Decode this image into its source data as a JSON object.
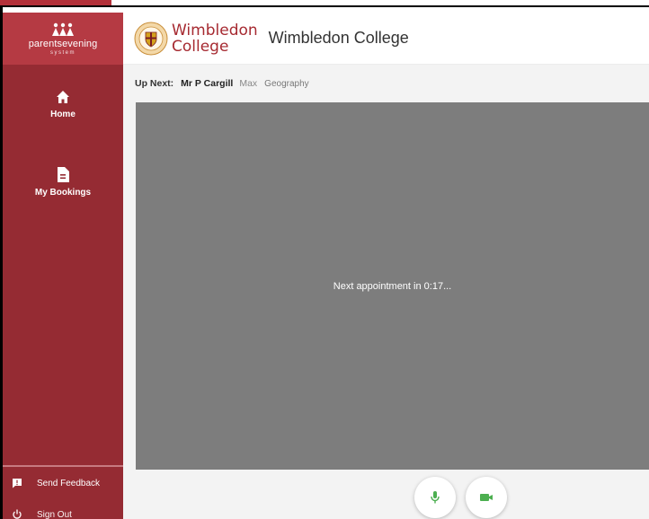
{
  "sidebar": {
    "brand_text": "parentsevening",
    "brand_sub": "system",
    "nav": [
      {
        "label": "Home",
        "icon": "home-icon"
      },
      {
        "label": "My Bookings",
        "icon": "document-icon"
      }
    ],
    "feedback_label": "Send Feedback",
    "signout_label": "Sign Out"
  },
  "header": {
    "logo_line1": "Wimbledon",
    "logo_line2": "College",
    "school_name": "Wimbledon College"
  },
  "upnext": {
    "label": "Up Next:",
    "teacher": "Mr P Cargill",
    "child": "Max",
    "subject": "Geography"
  },
  "video": {
    "message": "Next appointment in 0:17..."
  },
  "controls": {
    "mic_icon": "microphone-icon",
    "camera_icon": "video-camera-icon",
    "accent": "#4caf50"
  },
  "colors": {
    "sidebar": "#952b33",
    "brand": "#b53a43",
    "video_bg": "#7d7d7d"
  }
}
